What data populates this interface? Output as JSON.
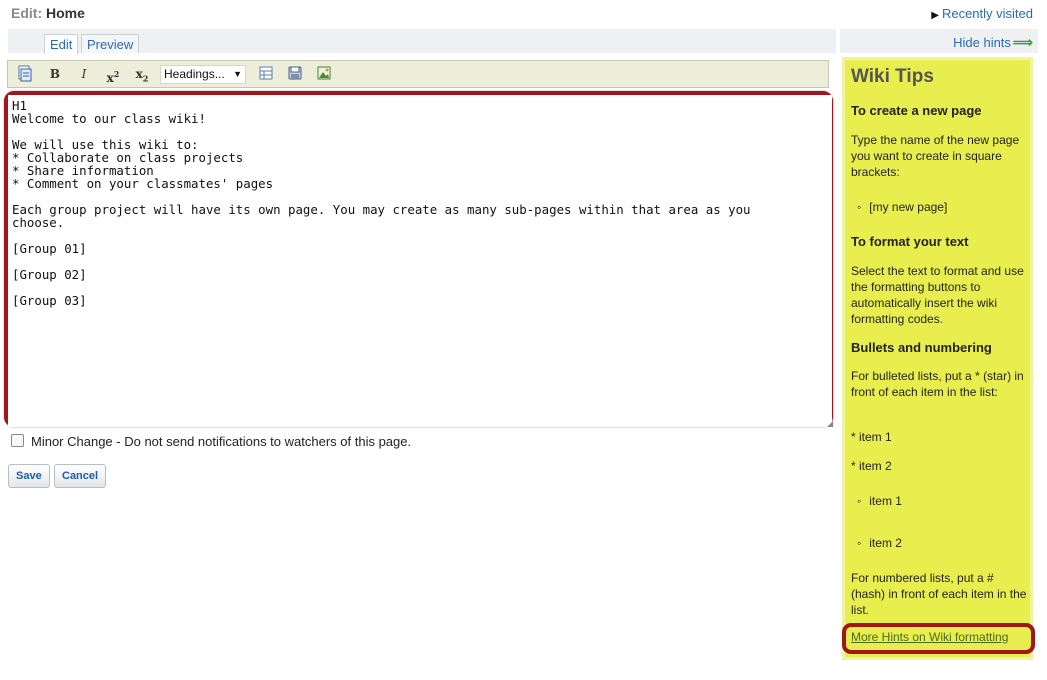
{
  "header": {
    "edit_label": "Edit:",
    "page_name": "Home",
    "recently_visited": "Recently visited"
  },
  "tabs": [
    {
      "label": "Edit",
      "active": true
    },
    {
      "label": "Preview",
      "active": false
    }
  ],
  "hints_toggle": "Hide hints",
  "toolbar": {
    "headings_select": "Headings...",
    "buttons": [
      "document-icon",
      "bold-icon",
      "italic-icon",
      "superscript-icon",
      "subscript-icon",
      "table-icon",
      "disk-icon",
      "image-icon"
    ],
    "bold_glyph": "B",
    "italic_glyph": "I",
    "sup_base": "x",
    "sup_exp": "2",
    "sub_base": "x",
    "sub_exp": "2"
  },
  "editor": {
    "content": "H1\nWelcome to our class wiki!\n\nWe will use this wiki to:\n* Collaborate on class projects\n* Share information\n* Comment on your classmates' pages\n\nEach group project will have its own page. You may create as many sub-pages within that area as you\nchoose.\n\n[Group 01]\n\n[Group 02]\n\n[Group 03]"
  },
  "minor_change": {
    "label": "Minor Change - Do not send notifications to watchers of this page.",
    "checked": false
  },
  "actions": {
    "save": "Save",
    "cancel": "Cancel"
  },
  "tips": {
    "title": "Wiki Tips",
    "create_heading": "To create a new page",
    "create_text": "Type the name of the new page you want to create in square brackets:",
    "create_example": "[my new page]",
    "format_heading": "To format your text",
    "format_text": "Select the text to format and use the formatting buttons to automatically insert the wiki formatting codes.",
    "bullets_heading": "Bullets and numbering",
    "bullets_text": "For bulleted lists, put a * (star) in front of each item in the list:",
    "star_item1": "* item 1",
    "star_item2": "* item 2",
    "bullet_item1": "item 1",
    "bullet_item2": "item 2",
    "numbered_text": "For numbered lists, put a # (hash) in front of each item in the list.",
    "more_link": "More Hints on Wiki formatting"
  },
  "colors": {
    "highlight_outline": "#a1161d",
    "tips_background": "#e8ee4e",
    "link": "#2a6ab5"
  }
}
